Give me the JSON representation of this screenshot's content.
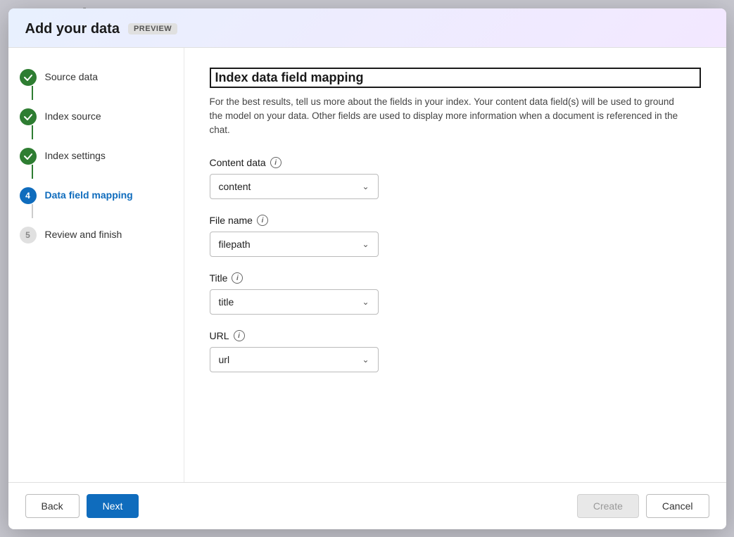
{
  "modal": {
    "title": "Add your data",
    "preview_badge": "PREVIEW"
  },
  "sidebar": {
    "steps": [
      {
        "id": "source-data",
        "label": "Source data",
        "state": "done",
        "number": "1"
      },
      {
        "id": "index-source",
        "label": "Index source",
        "state": "done",
        "number": "2"
      },
      {
        "id": "index-settings",
        "label": "Index settings",
        "state": "done",
        "number": "3"
      },
      {
        "id": "data-field-mapping",
        "label": "Data field mapping",
        "state": "active",
        "number": "4"
      },
      {
        "id": "review-and-finish",
        "label": "Review and finish",
        "state": "pending",
        "number": "5"
      }
    ]
  },
  "main": {
    "section_title": "Index data field mapping",
    "section_description": "For the best results, tell us more about the fields in your index. Your content data field(s) will be used to ground the model on your data. Other fields are used to display more information when a document is referenced in the chat.",
    "fields": [
      {
        "id": "content-data",
        "label": "Content data",
        "has_info": true,
        "value": "content"
      },
      {
        "id": "file-name",
        "label": "File name",
        "has_info": true,
        "value": "filepath"
      },
      {
        "id": "title",
        "label": "Title",
        "has_info": true,
        "value": "title"
      },
      {
        "id": "url",
        "label": "URL",
        "has_info": true,
        "value": "url"
      }
    ]
  },
  "footer": {
    "back_label": "Back",
    "next_label": "Next",
    "create_label": "Create",
    "cancel_label": "Cancel"
  },
  "icons": {
    "checkmark": "✓",
    "chevron_down": "⌄",
    "info_i": "i"
  }
}
